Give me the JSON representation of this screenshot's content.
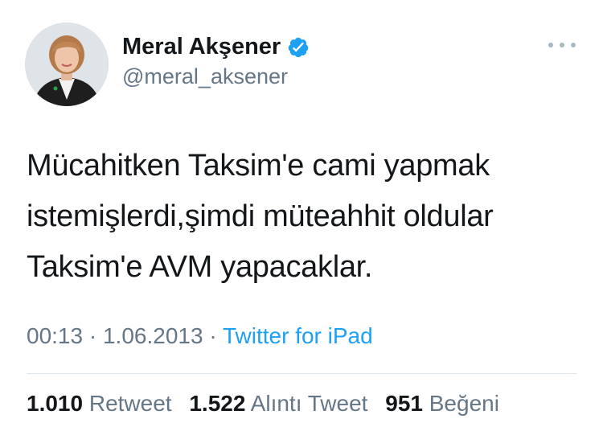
{
  "user": {
    "display_name": "Meral Akşener",
    "handle": "@meral_aksener",
    "verified": true,
    "avatar": "profile-photo"
  },
  "tweet": {
    "lines": [
      "Mücahitken Taksim'e cami yapmak",
      "istemişlerdi,şimdi müteahhit oldular",
      "Taksim'e AVM yapacaklar."
    ],
    "time": "00:13",
    "separator": "·",
    "date": "1.06.2013",
    "source": "Twitter for iPad"
  },
  "stats": {
    "retweets": {
      "count": "1.010",
      "label": "Retweet"
    },
    "quotes": {
      "count": "1.522",
      "label": "Alıntı Tweet"
    },
    "likes": {
      "count": "951",
      "label": "Beğeni"
    }
  },
  "icons": {
    "verified": "verified-badge-icon",
    "more": "more-options-icon"
  },
  "colors": {
    "accent": "#1da1f2",
    "secondary_text": "#657786",
    "primary_text": "#14171a"
  }
}
